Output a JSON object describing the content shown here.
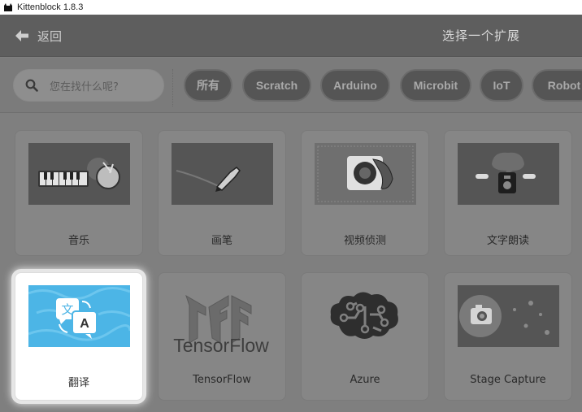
{
  "window": {
    "title": "Kittenblock 1.8.3"
  },
  "header": {
    "back_label": "返回",
    "title": "选择一个扩展"
  },
  "search": {
    "placeholder": "您在找什么呢?"
  },
  "filters": [
    {
      "label": "所有"
    },
    {
      "label": "Scratch"
    },
    {
      "label": "Arduino"
    },
    {
      "label": "Microbit"
    },
    {
      "label": "IoT"
    },
    {
      "label": "Robot"
    }
  ],
  "extensions": [
    {
      "name": "音乐",
      "icon": "music-keyboard-drum-icon"
    },
    {
      "name": "画笔",
      "icon": "pen-icon"
    },
    {
      "name": "视频侦测",
      "icon": "video-sensing-icon"
    },
    {
      "name": "文字朗读",
      "icon": "text-to-speech-icon"
    },
    {
      "name": "翻译",
      "icon": "translate-icon",
      "selected": true
    },
    {
      "name": "TensorFlow",
      "icon": "tensorflow-logo-icon",
      "logo_text": "TensorFlow"
    },
    {
      "name": "Azure",
      "icon": "azure-brain-icon"
    },
    {
      "name": "Stage Capture",
      "icon": "camera-icon"
    }
  ],
  "colors": {
    "header": "#5e5e5e",
    "overlay": "#7f7f7f",
    "chip": "#555555",
    "translate_accent": "#4cb5e6"
  }
}
